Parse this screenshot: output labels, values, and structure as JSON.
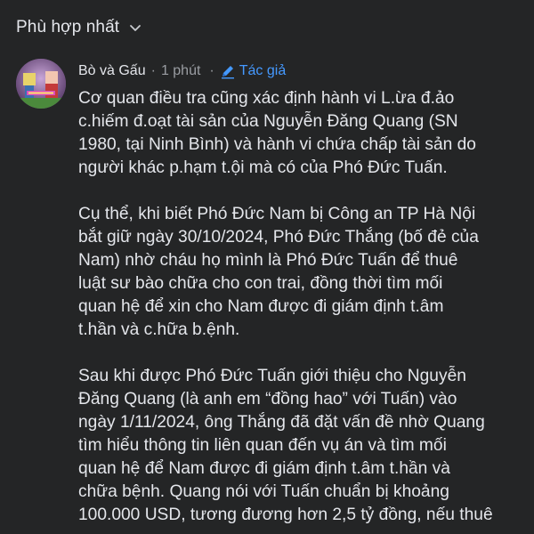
{
  "sort": {
    "label": "Phù hợp nhất",
    "icon": "chevron-down-icon"
  },
  "comment": {
    "author": "Bò và Gấu",
    "separator": "·",
    "time": "1 phút",
    "separator2": "·",
    "author_badge": "Tác giả",
    "author_badge_icon": "pen-icon",
    "badge_color": "#4599ff",
    "paragraphs": [
      "Cơ quan điều tra cũng xác định hành vi L.ừa đ.ảo\nc.hiếm đ.oạt tài sản của Nguyễn Đăng Quang (SN\n1980, tại Ninh Bình) và hành vi chứa chấp tài sản do\nngười khác p.hạm t.ội mà có của Phó Đức Tuấn.",
      "Cụ thể, khi biết Phó Đức Nam bị Công an TP Hà Nội\nbắt giữ ngày 30/10/2024, Phó Đức Thắng (bố đẻ của\nNam) nhờ cháu họ mình là Phó Đức Tuấn để thuê\nluật sư bào chữa cho con trai, đồng thời tìm mối\nquan hệ để xin cho Nam được đi giám định t.âm\nt.hần và c.hữa b.ệnh.",
      "Sau khi được Phó Đức Tuấn giới thiệu cho Nguyễn\nĐăng Quang (là anh em “đồng hao” với Tuấn) vào\nngày 1/11/2024, ông Thắng đã đặt vấn đề nhờ Quang\ntìm hiểu thông tin liên quan đến vụ án và tìm mối\nquan hệ để Nam được đi giám định t.âm t.hần và\nchữa bệnh. Quang nói với Tuấn chuẩn bị khoảng\n100.000 USD, tương đương hơn 2,5 tỷ đồng, nếu thuê"
    ]
  }
}
